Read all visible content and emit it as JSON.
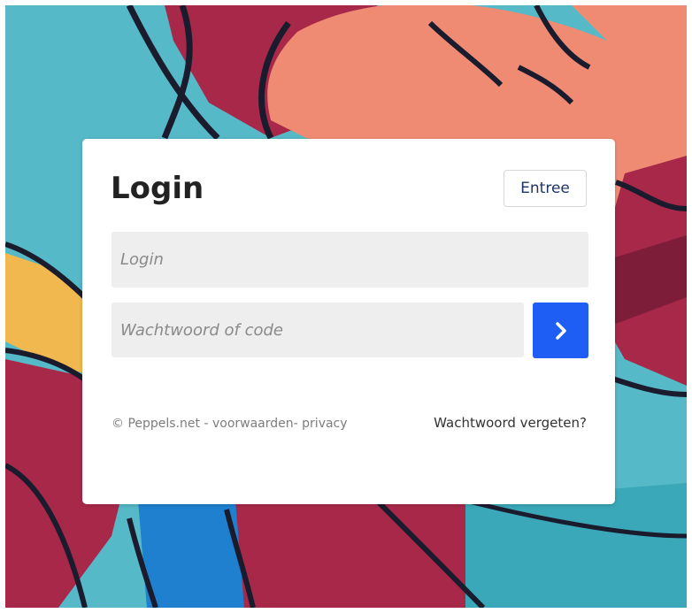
{
  "login_card": {
    "title": "Login",
    "entree_button_label": "Entree",
    "login_field": {
      "value": "",
      "placeholder": "Login"
    },
    "password_field": {
      "value": "",
      "placeholder": "Wachtwoord of code"
    },
    "submit_icon": "chevron-right-icon",
    "submit_color": "#1f5ef5"
  },
  "footer": {
    "copyright": "© Peppels.net",
    "separator1": " - ",
    "terms_link": "voorwaarden",
    "separator2": "- ",
    "privacy_link": "privacy",
    "forgot_password_link": "Wachtwoord vergeten?"
  }
}
